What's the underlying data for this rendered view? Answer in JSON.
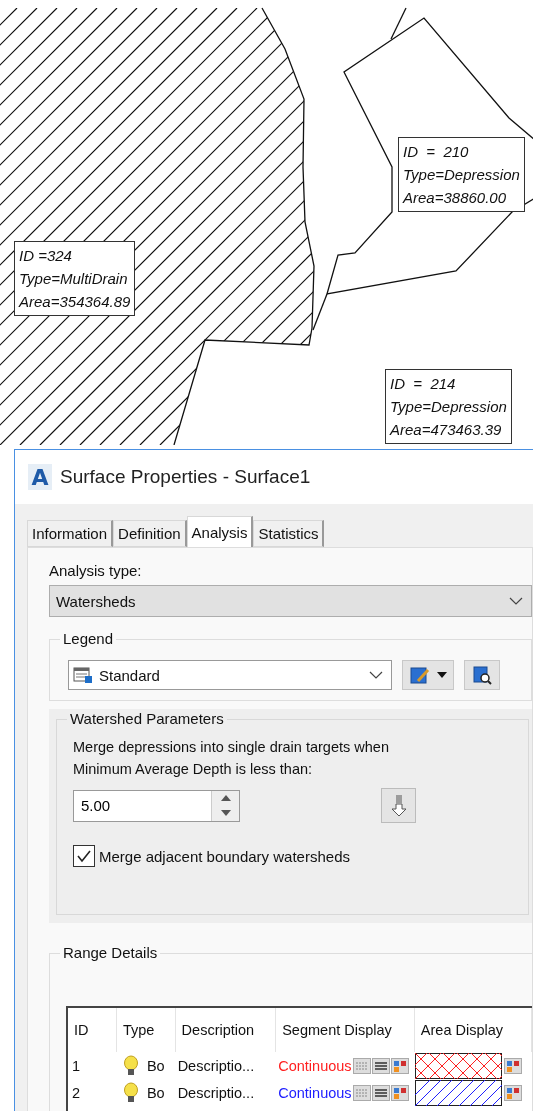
{
  "drawing": {
    "labels": [
      {
        "id": "ID =324",
        "type": "Type=MultiDrain",
        "area": "Area=354364.89"
      },
      {
        "id": "ID  =  210",
        "type": "Type=Depression",
        "area": "Area=38860.00"
      },
      {
        "id": "ID  =  214",
        "type": "Type=Depression",
        "area": "Area=473463.39"
      }
    ]
  },
  "dialog": {
    "app_icon_letter": "A",
    "title": "Surface Properties - Surface1",
    "tabs": [
      {
        "label": "Information",
        "selected": false
      },
      {
        "label": "Definition",
        "selected": false
      },
      {
        "label": "Analysis",
        "selected": true
      },
      {
        "label": "Statistics",
        "selected": false
      }
    ],
    "analysis_type": {
      "label": "Analysis type:",
      "value": "Watersheds"
    },
    "legend": {
      "title": "Legend",
      "value": "Standard"
    },
    "watershed_parameters": {
      "title": "Watershed Parameters",
      "description": "Merge depressions into single drain targets when Minimum Average Depth is less than:",
      "depth_value": "5.00",
      "merge_boundary": {
        "label": "Merge adjacent boundary watersheds",
        "checked": true
      }
    },
    "range_details": {
      "title": "Range Details",
      "columns": [
        "ID",
        "Type",
        "Description",
        "Segment Display",
        "Area Display"
      ],
      "rows": [
        {
          "id": "1",
          "type": "Bo",
          "description": "Descriptio...",
          "segment": "Continuous",
          "color": "#ff2020",
          "kind": "cross"
        },
        {
          "id": "2",
          "type": "Bo",
          "description": "Descriptio...",
          "segment": "Continuous",
          "color": "#2020ff",
          "kind": "diagonal"
        }
      ]
    }
  }
}
